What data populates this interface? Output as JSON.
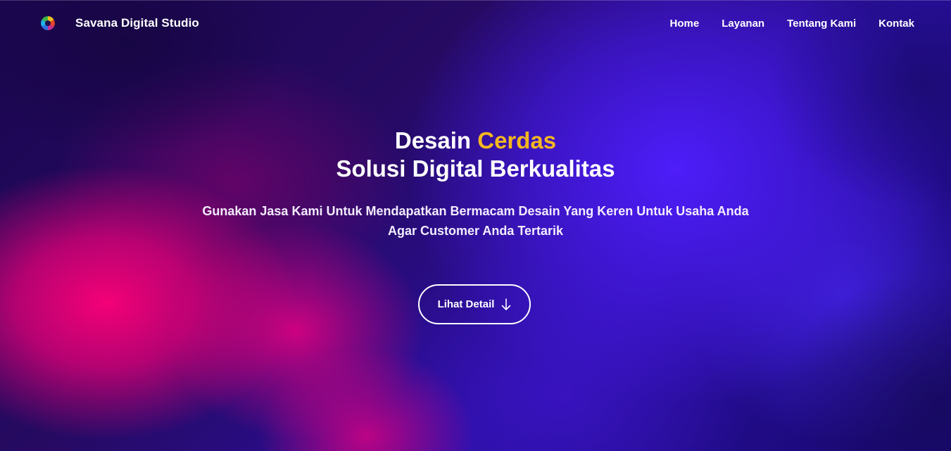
{
  "brand": {
    "name": "Savana Digital Studio",
    "logo_icon": "colorful-pinwheel-icon"
  },
  "nav": {
    "items": [
      {
        "label": "Home"
      },
      {
        "label": "Layanan"
      },
      {
        "label": "Tentang Kami"
      },
      {
        "label": "Kontak"
      }
    ]
  },
  "hero": {
    "headline_part1": "Desain",
    "headline_accent": "Cerdas",
    "headline_line2": "Solusi Digital Berkualitas",
    "subtitle_line1": "Gunakan Jasa Kami Untuk Mendapatkan Bermacam Desain Yang Keren Untuk Usaha Anda",
    "subtitle_line2": "Agar Customer Anda Tertarik",
    "cta_label": "Lihat Detail",
    "cta_icon": "arrow-down-icon"
  },
  "colors": {
    "accent": "#f5b71f",
    "text": "#ffffff"
  }
}
